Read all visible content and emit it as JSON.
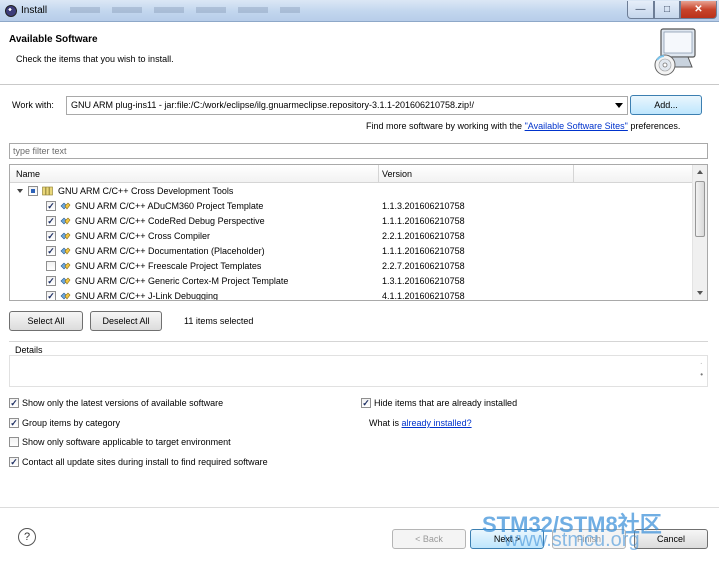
{
  "window": {
    "title": "Install"
  },
  "header": {
    "title": "Available Software",
    "subtitle": "Check the items that you wish to install."
  },
  "work_with": {
    "label": "Work with:",
    "value": "GNU ARM plug-ins11 - jar:file:/C:/work/eclipse/ilg.gnuarmeclipse.repository-3.1.1-201606210758.zip!/",
    "add_button": "Add..."
  },
  "find_more": {
    "prefix": "Find more software by working with the",
    "link": "\"Available Software Sites\"",
    "suffix": "preferences."
  },
  "filter": {
    "placeholder": "type filter text"
  },
  "table": {
    "columns": [
      "Name",
      "Version"
    ],
    "category": {
      "label": "GNU ARM C/C++ Cross Development Tools",
      "state": "partial"
    },
    "rows": [
      {
        "name": "GNU ARM C/C++ ADuCM360 Project Template",
        "version": "1.1.3.201606210758",
        "checked": true
      },
      {
        "name": "GNU ARM C/C++ CodeRed Debug Perspective",
        "version": "1.1.1.201606210758",
        "checked": true
      },
      {
        "name": "GNU ARM C/C++ Cross Compiler",
        "version": "2.2.1.201606210758",
        "checked": true
      },
      {
        "name": "GNU ARM C/C++ Documentation (Placeholder)",
        "version": "1.1.1.201606210758",
        "checked": true
      },
      {
        "name": "GNU ARM C/C++ Freescale Project Templates",
        "version": "2.2.7.201606210758",
        "checked": false
      },
      {
        "name": "GNU ARM C/C++ Generic Cortex-M Project Template",
        "version": "1.3.1.201606210758",
        "checked": true
      },
      {
        "name": "GNU ARM C/C++ J-Link Debugging",
        "version": "4.1.1.201606210758",
        "checked": true
      }
    ]
  },
  "selection": {
    "select_all": "Select All",
    "deselect_all": "Deselect All",
    "status": "11 items selected"
  },
  "details": {
    "label": "Details"
  },
  "options": {
    "latest_versions": {
      "label": "Show only the latest versions of available software",
      "checked": true
    },
    "group_by_category": {
      "label": "Group items by category",
      "checked": true
    },
    "applicable_only": {
      "label": "Show only software applicable to target environment",
      "checked": false
    },
    "contact_sites": {
      "label": "Contact all update sites during install to find required software",
      "checked": true
    },
    "hide_installed": {
      "label": "Hide items that are already installed",
      "checked": true
    },
    "what_is": {
      "prefix": "What is",
      "link": "already installed",
      "suffix": "?"
    }
  },
  "footer": {
    "help": "?",
    "back": "< Back",
    "next": "Next >",
    "finish": "Finish",
    "cancel": "Cancel"
  },
  "watermark": {
    "line1": "STM32/STM8社区",
    "line2": "www.stmcu.org"
  },
  "colors": {
    "link": "#0033cc",
    "accent": "#3c7fb1",
    "watermark": "#3a8fd9"
  }
}
